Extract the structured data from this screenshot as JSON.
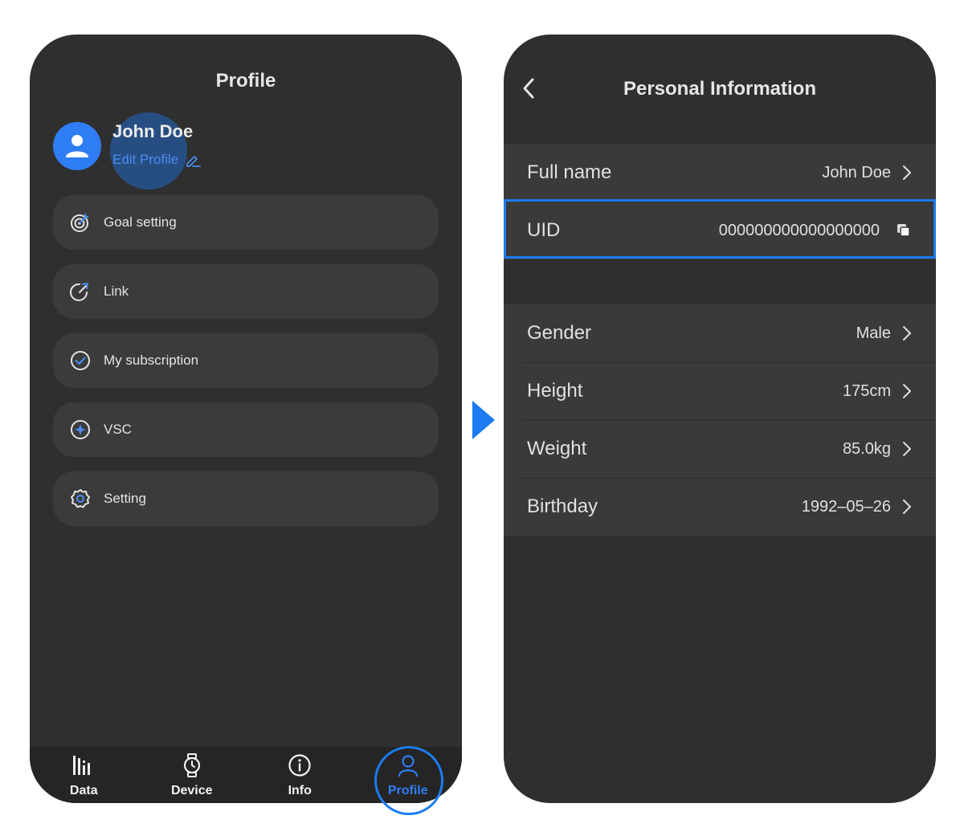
{
  "profile_screen": {
    "title": "Profile",
    "user_name": "John Doe",
    "edit_profile_label": "Edit Profile",
    "menu": [
      {
        "label": "Goal setting",
        "icon": "target-icon"
      },
      {
        "label": "Link",
        "icon": "share-icon"
      },
      {
        "label": "My subscription",
        "icon": "check-circle-icon"
      },
      {
        "label": "VSC",
        "icon": "compass-icon"
      },
      {
        "label": "Setting",
        "icon": "gear-icon"
      }
    ],
    "tabs": [
      {
        "label": "Data",
        "icon": "bar-chart-icon"
      },
      {
        "label": "Device",
        "icon": "watch-icon"
      },
      {
        "label": "Info",
        "icon": "info-icon"
      },
      {
        "label": "Profile",
        "icon": "person-icon",
        "active": true
      }
    ]
  },
  "personal_info_screen": {
    "title": "Personal Information",
    "rows": {
      "full_name": {
        "label": "Full name",
        "value": "John Doe"
      },
      "uid": {
        "label": "UID",
        "value": "000000000000000000"
      },
      "gender": {
        "label": "Gender",
        "value": "Male"
      },
      "height": {
        "label": "Height",
        "value": "175cm"
      },
      "weight": {
        "label": "Weight",
        "value": "85.0kg"
      },
      "birthday": {
        "label": "Birthday",
        "value": "1992–05–26"
      }
    }
  },
  "colors": {
    "accent": "#2f7df5",
    "highlight": "#1a7cf0",
    "background": "#2f2f2f",
    "card": "#3b3b3b"
  }
}
